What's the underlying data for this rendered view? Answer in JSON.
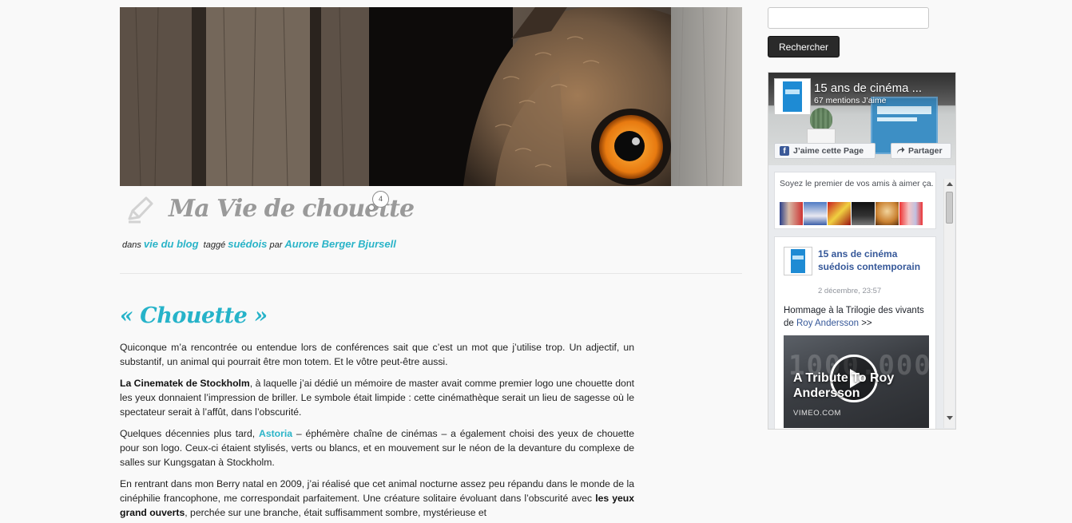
{
  "post": {
    "title": "Ma Vie de chouette",
    "comment_count": "4",
    "meta_in": "dans",
    "category": "vie du blog",
    "meta_tagged": "taggé",
    "tag": "suédois",
    "meta_by": "par",
    "author": "Aurore Berger Bjursell"
  },
  "article": {
    "heading": "« Chouette »",
    "p1": "Quiconque m’a rencontrée ou entendue lors de conférences sait que c’est un mot que j’utilise trop. Un adjectif, un substantif, un animal qui pourrait être mon totem. Et le vôtre peut-être aussi.",
    "p2_bold": "La Cinematek de Stockholm",
    "p2_rest": ", à laquelle j’ai dédié un mémoire de master avait comme premier logo une chouette dont les yeux donnaient l’impression de briller. Le symbole était limpide : cette cinémathèque serait un lieu de sagesse où le spectateur serait à l’affût, dans l’obscurité.",
    "p3_start": "Quelques décennies plus tard, ",
    "p3_link": "Astoria",
    "p3_rest": " – éphémère chaîne de cinémas – a également choisi des yeux de chouette pour son logo. Ceux-ci étaient stylisés, verts ou blancs, et en mouvement sur le néon de la devanture du complexe de salles sur Kungsgatan à Stockholm.",
    "p4_start": "En rentrant dans mon Berry natal en 2009, j’ai réalisé que cet animal nocturne assez peu répandu dans le monde de la cinéphilie francophone, me correspondait parfaitement. Une créature solitaire évoluant dans l’obscurité avec ",
    "p4_bold": "les yeux grand ouverts",
    "p4_rest": ", perchée sur une branche, était suffisamment sombre, mystérieuse et"
  },
  "sidebar": {
    "search_placeholder": "",
    "search_button": "Rechercher"
  },
  "facebook": {
    "page_name": "15 ans de cinéma ...",
    "likes": "67 mentions J’aime",
    "like_button": "J’aime cette Page",
    "share_button": "Partager",
    "friends_text": "Soyez le premier de vos amis à aimer ça.",
    "post_title": "15 ans de cinéma suédois contemporain",
    "post_date": "2 décembre, 23:57",
    "post_text_start": "Hommage à la Trilogie des vivants de ",
    "post_text_link": "Roy Andersson",
    "post_text_end": " >>",
    "video_title": "A Tribute To Roy Andersson",
    "video_source": "VIMEO.COM",
    "video_digits": "1000.000"
  },
  "colors": {
    "accent": "#2ab4c8",
    "title_grey": "#9a9a9a",
    "facebook_blue": "#3b5998",
    "facebook_link": "#365899"
  }
}
